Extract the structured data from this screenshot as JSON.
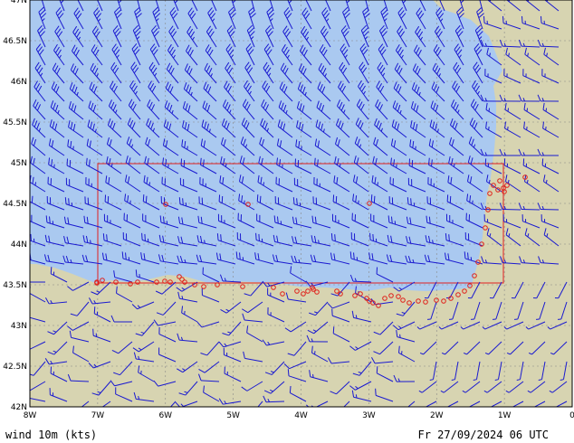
{
  "map": {
    "lat_labels": [
      "47N",
      "46.5N",
      "46N",
      "45.5N",
      "45N",
      "44.5N",
      "44N",
      "43.5N",
      "43N",
      "42.5N",
      "42N"
    ],
    "lon_labels": [
      "8W",
      "7W",
      "6W",
      "5W",
      "4W",
      "3W",
      "2W",
      "1W",
      "0"
    ],
    "lat_range": [
      42,
      47
    ],
    "lon_range": [
      -8,
      0
    ],
    "grid": true,
    "colors": {
      "sea": "#aac9f0",
      "land": "#d7d4b1",
      "outer_land": "#c8c8b0",
      "barbs": "#1a1ad0",
      "stations": "#e0201a",
      "subregion_box": "#e02020",
      "grid": "#888888"
    }
  },
  "caption": {
    "left": "wind 10m (kts)",
    "right": "Fr 27/09/2024 06 UTC"
  }
}
